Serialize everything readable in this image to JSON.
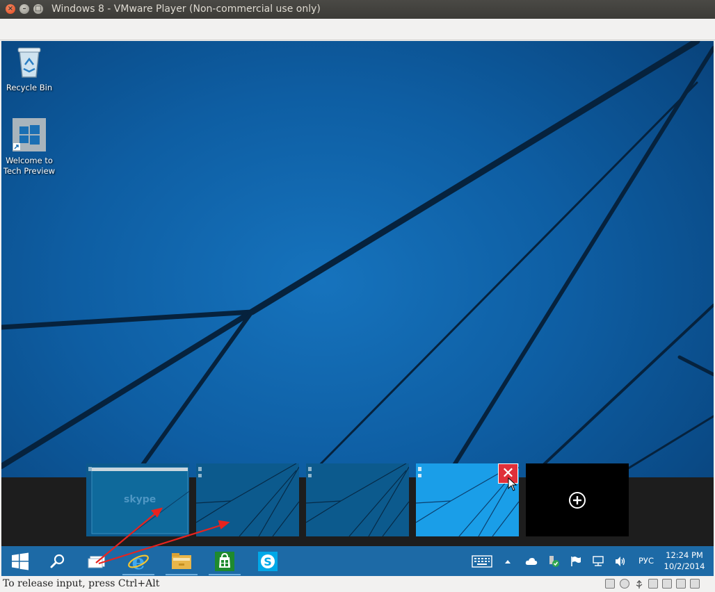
{
  "window": {
    "title": "Windows 8 - VMware Player (Non-commercial use only)",
    "close_glyph": "×",
    "minimize_glyph": "–",
    "maximize_glyph": "□"
  },
  "desktop": {
    "icons": [
      {
        "label_line1": "Recycle Bin",
        "label_line2": "",
        "icon": "recycle-bin-icon"
      },
      {
        "label_line1": "Welcome to",
        "label_line2": "Tech Preview",
        "icon": "windows-logo-icon"
      }
    ]
  },
  "task_view": {
    "thumbnails": [
      {
        "name": "desktop-1",
        "content": "skype"
      },
      {
        "name": "desktop-2",
        "content": "wallpaper"
      },
      {
        "name": "desktop-3",
        "content": "wallpaper"
      },
      {
        "name": "desktop-4",
        "content": "wallpaper-bright",
        "selected": true
      }
    ],
    "skype_label": "skype",
    "close_glyph": "✕",
    "add_icon": "plus-circle-icon"
  },
  "taskbar": {
    "items": [
      {
        "name": "start-button",
        "icon": "windows-logo-icon"
      },
      {
        "name": "search-button",
        "icon": "search-icon"
      },
      {
        "name": "task-view-button",
        "icon": "task-view-icon"
      },
      {
        "name": "internet-explorer-button",
        "icon": "internet-explorer-icon"
      },
      {
        "name": "file-explorer-button",
        "icon": "folder-icon"
      },
      {
        "name": "store-button",
        "icon": "store-icon"
      },
      {
        "name": "skype-button",
        "icon": "skype-icon"
      }
    ],
    "tray": {
      "language": "РУС",
      "time": "12:24 PM",
      "date": "10/2/2014"
    }
  },
  "statusbar": {
    "text": "To release input, press Ctrl+Alt"
  },
  "colors": {
    "taskbar": "#1d6aa6",
    "title_bar": "#3c3b37",
    "close_red": "#e0303a",
    "annotation_arrow": "#e8231e"
  }
}
